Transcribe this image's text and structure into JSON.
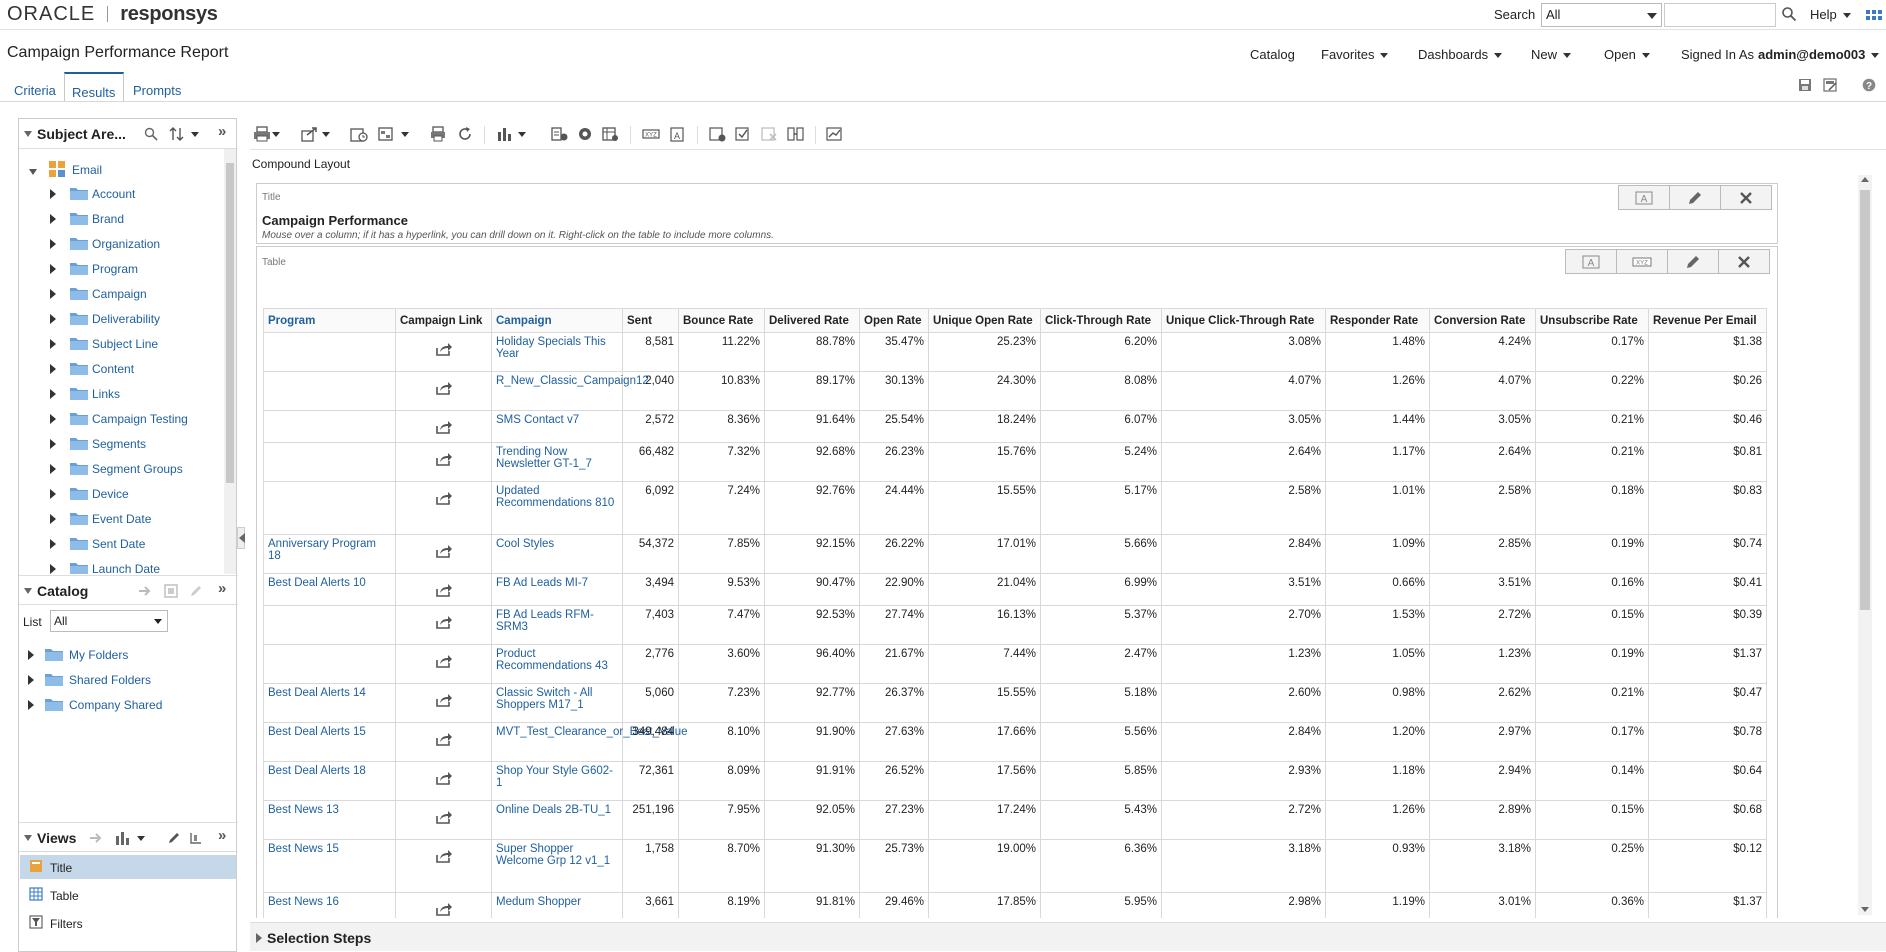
{
  "brand": {
    "oracle": "ORACLE",
    "product": "responsys"
  },
  "topbar": {
    "search_label": "Search",
    "search_scope": "All",
    "help_label": "Help"
  },
  "header": {
    "title": "Campaign Performance Report",
    "nav": [
      "Catalog",
      "Favorites",
      "Dashboards",
      "New",
      "Open"
    ],
    "signed_in_label": "Signed In As",
    "user": "admin@demo003"
  },
  "tabs": [
    "Criteria",
    "Results",
    "Prompts"
  ],
  "subject_areas": {
    "title": "Subject Are...",
    "root": "Email",
    "items": [
      "Account",
      "Brand",
      "Organization",
      "Program",
      "Campaign",
      "Deliverability",
      "Subject Line",
      "Content",
      "Links",
      "Campaign Testing",
      "Segments",
      "Segment Groups",
      "Device",
      "Event Date",
      "Sent Date",
      "Launch Date"
    ]
  },
  "catalog": {
    "title": "Catalog",
    "list_label": "List",
    "list_value": "All",
    "items": [
      "My Folders",
      "Shared Folders",
      "Company Shared"
    ]
  },
  "views": {
    "title": "Views",
    "items": [
      "Title",
      "Table",
      "Filters"
    ]
  },
  "main": {
    "compound_label": "Compound Layout",
    "title_box_label": "Title",
    "report_title": "Campaign Performance",
    "report_subtitle": "Mouse over a column; if it has a hyperlink, you can drill down on it. Right-click on the table to include more columns.",
    "table_box_label": "Table",
    "selection_steps": "Selection Steps"
  },
  "table": {
    "headers": [
      "Program",
      "Campaign Link",
      "Campaign",
      "Sent",
      "Bounce Rate",
      "Delivered Rate",
      "Open Rate",
      "Unique Open Rate",
      "Click-Through Rate",
      "Unique Click-Through Rate",
      "Responder Rate",
      "Conversion Rate",
      "Unsubscribe Rate",
      "Revenue Per Email"
    ],
    "rows": [
      {
        "program": "",
        "campaign": "Holiday Specials This Year",
        "sent": "8,581",
        "bounce": "11.22%",
        "delivered": "88.78%",
        "open": "35.47%",
        "uopen": "25.23%",
        "ctr": "6.20%",
        "uctr": "3.08%",
        "resp": "1.48%",
        "conv": "4.24%",
        "unsub": "0.17%",
        "rev": "$1.38"
      },
      {
        "program": "",
        "campaign": "R_New_Classic_Campaign12",
        "sent": "2,040",
        "bounce": "10.83%",
        "delivered": "89.17%",
        "open": "30.13%",
        "uopen": "24.30%",
        "ctr": "8.08%",
        "uctr": "4.07%",
        "resp": "1.26%",
        "conv": "4.07%",
        "unsub": "0.22%",
        "rev": "$0.26"
      },
      {
        "program": "",
        "campaign": "SMS Contact v7",
        "sent": "2,572",
        "bounce": "8.36%",
        "delivered": "91.64%",
        "open": "25.54%",
        "uopen": "18.24%",
        "ctr": "6.07%",
        "uctr": "3.05%",
        "resp": "1.44%",
        "conv": "3.05%",
        "unsub": "0.21%",
        "rev": "$0.46"
      },
      {
        "program": "",
        "campaign": "Trending Now Newsletter GT-1_7",
        "sent": "66,482",
        "bounce": "7.32%",
        "delivered": "92.68%",
        "open": "26.23%",
        "uopen": "15.76%",
        "ctr": "5.24%",
        "uctr": "2.64%",
        "resp": "1.17%",
        "conv": "2.64%",
        "unsub": "0.21%",
        "rev": "$0.81"
      },
      {
        "program": "",
        "campaign": "Updated Recommendations 810",
        "sent": "6,092",
        "bounce": "7.24%",
        "delivered": "92.76%",
        "open": "24.44%",
        "uopen": "15.55%",
        "ctr": "5.17%",
        "uctr": "2.58%",
        "resp": "1.01%",
        "conv": "2.58%",
        "unsub": "0.18%",
        "rev": "$0.83"
      },
      {
        "program": "Anniversary Program 18",
        "campaign": "Cool Styles",
        "sent": "54,372",
        "bounce": "7.85%",
        "delivered": "92.15%",
        "open": "26.22%",
        "uopen": "17.01%",
        "ctr": "5.66%",
        "uctr": "2.84%",
        "resp": "1.09%",
        "conv": "2.85%",
        "unsub": "0.19%",
        "rev": "$0.74"
      },
      {
        "program": "Best Deal Alerts 10",
        "campaign": "FB Ad Leads MI-7",
        "sent": "3,494",
        "bounce": "9.53%",
        "delivered": "90.47%",
        "open": "22.90%",
        "uopen": "21.04%",
        "ctr": "6.99%",
        "uctr": "3.51%",
        "resp": "0.66%",
        "conv": "3.51%",
        "unsub": "0.16%",
        "rev": "$0.41"
      },
      {
        "program": "",
        "campaign": "FB Ad Leads RFM-SRM3",
        "sent": "7,403",
        "bounce": "7.47%",
        "delivered": "92.53%",
        "open": "27.74%",
        "uopen": "16.13%",
        "ctr": "5.37%",
        "uctr": "2.70%",
        "resp": "1.53%",
        "conv": "2.72%",
        "unsub": "0.15%",
        "rev": "$0.39"
      },
      {
        "program": "",
        "campaign": "Product Recommendations 43",
        "sent": "2,776",
        "bounce": "3.60%",
        "delivered": "96.40%",
        "open": "21.67%",
        "uopen": "7.44%",
        "ctr": "2.47%",
        "uctr": "1.23%",
        "resp": "1.05%",
        "conv": "1.23%",
        "unsub": "0.19%",
        "rev": "$1.37"
      },
      {
        "program": "Best Deal Alerts 14",
        "campaign": "Classic Switch - All Shoppers M17_1",
        "sent": "5,060",
        "bounce": "7.23%",
        "delivered": "92.77%",
        "open": "26.37%",
        "uopen": "15.55%",
        "ctr": "5.18%",
        "uctr": "2.60%",
        "resp": "0.98%",
        "conv": "2.62%",
        "unsub": "0.21%",
        "rev": "$0.47"
      },
      {
        "program": "Best Deal Alerts 15",
        "campaign": "MVT_Test_Clearance_or_Best_Value",
        "sent": "349,484",
        "bounce": "8.10%",
        "delivered": "91.90%",
        "open": "27.63%",
        "uopen": "17.66%",
        "ctr": "5.56%",
        "uctr": "2.84%",
        "resp": "1.20%",
        "conv": "2.97%",
        "unsub": "0.17%",
        "rev": "$0.78"
      },
      {
        "program": "Best Deal Alerts 18",
        "campaign": "Shop Your Style G602-1",
        "sent": "72,361",
        "bounce": "8.09%",
        "delivered": "91.91%",
        "open": "26.52%",
        "uopen": "17.56%",
        "ctr": "5.85%",
        "uctr": "2.93%",
        "resp": "1.18%",
        "conv": "2.94%",
        "unsub": "0.14%",
        "rev": "$0.64"
      },
      {
        "program": "Best News 13",
        "campaign": "Online Deals 2B-TU_1",
        "sent": "251,196",
        "bounce": "7.95%",
        "delivered": "92.05%",
        "open": "27.23%",
        "uopen": "17.24%",
        "ctr": "5.43%",
        "uctr": "2.72%",
        "resp": "1.26%",
        "conv": "2.89%",
        "unsub": "0.15%",
        "rev": "$0.68"
      },
      {
        "program": "Best News 15",
        "campaign": "Super Shopper Welcome Grp 12 v1_1",
        "sent": "1,758",
        "bounce": "8.70%",
        "delivered": "91.30%",
        "open": "25.73%",
        "uopen": "19.00%",
        "ctr": "6.36%",
        "uctr": "3.18%",
        "resp": "0.93%",
        "conv": "3.18%",
        "unsub": "0.25%",
        "rev": "$0.12"
      },
      {
        "program": "Best News 16",
        "campaign": "Medum Shopper",
        "sent": "3,661",
        "bounce": "8.19%",
        "delivered": "91.81%",
        "open": "29.46%",
        "uopen": "17.85%",
        "ctr": "5.95%",
        "uctr": "2.98%",
        "resp": "1.19%",
        "conv": "3.01%",
        "unsub": "0.36%",
        "rev": "$1.37"
      }
    ]
  }
}
